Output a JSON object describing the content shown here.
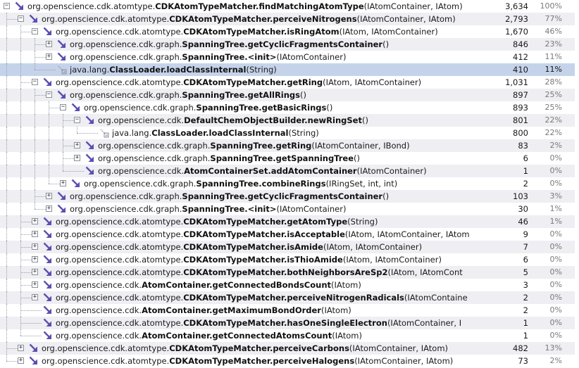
{
  "colors": {
    "selected_row": "#c5d3ea",
    "alt_row": "#eeeef3",
    "arrow_icon": "#5b4fb0"
  },
  "rows": [
    {
      "indent": 0,
      "toggle": "-",
      "icon": "arrow",
      "prefix": "org.opensciencecdk.atomtype.",
      "prefix_fix": "org.openscience.cdk.atomtype.",
      "bold": "CDKAtomTypeMatcher.findMatchingAtomType",
      "suffix": "(IAtomContainer, IAtom)",
      "count": "3,634",
      "pct": "100%"
    },
    {
      "indent": 1,
      "toggle": "-",
      "icon": "arrow",
      "prefix_fix": "org.openscience.cdk.atomtype.",
      "bold": "CDKAtomTypeMatcher.perceiveNitrogens",
      "suffix": "(IAtomContainer, IAtom)",
      "count": "2,793",
      "pct": "77%"
    },
    {
      "indent": 2,
      "toggle": "-",
      "icon": "arrow",
      "prefix_fix": "org.openscience.cdk.atomtype.",
      "bold": "CDKAtomTypeMatcher.isRingAtom",
      "suffix": "(IAtom, IAtomContainer)",
      "count": "1,670",
      "pct": "46%"
    },
    {
      "indent": 3,
      "toggle": "+",
      "icon": "arrow",
      "prefix_fix": "org.openscience.cdk.graph.",
      "bold": "SpanningTree.getCyclicFragmentsContainer",
      "suffix": "()",
      "count": "846",
      "pct": "23%"
    },
    {
      "indent": 3,
      "toggle": "+",
      "icon": "arrow",
      "prefix_fix": "org.openscience.cdk.graph.",
      "bold": "SpanningTree.<init>",
      "suffix": "(IAtomContainer)",
      "count": "412",
      "pct": "11%"
    },
    {
      "indent": 3,
      "toggle": "",
      "icon": "self",
      "prefix_fix": "java.lang.",
      "bold": "ClassLoader.loadClassInternal",
      "suffix": "(String)",
      "count": "410",
      "pct": "11%",
      "selected": true
    },
    {
      "indent": 2,
      "toggle": "-",
      "icon": "arrow",
      "prefix_fix": "org.openscience.cdk.atomtype.",
      "bold": "CDKAtomTypeMatcher.getRing",
      "suffix": "(IAtom, IAtomContainer)",
      "count": "1,031",
      "pct": "28%"
    },
    {
      "indent": 3,
      "toggle": "-",
      "icon": "arrow",
      "prefix_fix": "org.openscience.cdk.graph.",
      "bold": "SpanningTree.getAllRings",
      "suffix": "()",
      "count": "897",
      "pct": "25%"
    },
    {
      "indent": 4,
      "toggle": "-",
      "icon": "arrow",
      "prefix_fix": "org.openscience.cdk.graph.",
      "bold": "SpanningTree.getBasicRings",
      "suffix": "()",
      "count": "893",
      "pct": "25%"
    },
    {
      "indent": 5,
      "toggle": "-",
      "icon": "arrow",
      "prefix_fix": "org.openscience.cdk.",
      "bold": "DefaultChemObjectBuilder.newRingSet",
      "suffix": "()",
      "count": "801",
      "pct": "22%"
    },
    {
      "indent": 6,
      "toggle": "",
      "icon": "self",
      "prefix_fix": "java.lang.",
      "bold": "ClassLoader.loadClassInternal",
      "suffix": "(String)",
      "count": "800",
      "pct": "22%"
    },
    {
      "indent": 5,
      "toggle": "+",
      "icon": "arrow",
      "prefix_fix": "org.openscience.cdk.graph.",
      "bold": "SpanningTree.getRing",
      "suffix": "(IAtomContainer, IBond)",
      "count": "83",
      "pct": "2%"
    },
    {
      "indent": 5,
      "toggle": "+",
      "icon": "arrow",
      "prefix_fix": "org.openscience.cdk.graph.",
      "bold": "SpanningTree.getSpanningTree",
      "suffix": "()",
      "count": "6",
      "pct": "0%"
    },
    {
      "indent": 5,
      "toggle": "",
      "icon": "arrow",
      "prefix_fix": "org.openscience.cdk.",
      "bold": "AtomContainerSet.addAtomContainer",
      "suffix": "(IAtomContainer)",
      "count": "1",
      "pct": "0%"
    },
    {
      "indent": 4,
      "toggle": "+",
      "icon": "arrow",
      "prefix_fix": "org.openscience.cdk.graph.",
      "bold": "SpanningTree.combineRings",
      "suffix": "(IRingSet, int, int)",
      "count": "2",
      "pct": "0%"
    },
    {
      "indent": 3,
      "toggle": "+",
      "icon": "arrow",
      "prefix_fix": "org.openscience.cdk.graph.",
      "bold": "SpanningTree.getCyclicFragmentsContainer",
      "suffix": "()",
      "count": "103",
      "pct": "3%"
    },
    {
      "indent": 3,
      "toggle": "+",
      "icon": "arrow",
      "prefix_fix": "org.openscience.cdk.graph.",
      "bold": "SpanningTree.<init>",
      "suffix": "(IAtomContainer)",
      "count": "30",
      "pct": "1%"
    },
    {
      "indent": 2,
      "toggle": "+",
      "icon": "arrow",
      "prefix_fix": "org.openscience.cdk.atomtype.",
      "bold": "CDKAtomTypeMatcher.getAtomType",
      "suffix": "(String)",
      "count": "46",
      "pct": "1%"
    },
    {
      "indent": 2,
      "toggle": "+",
      "icon": "arrow",
      "prefix_fix": "org.openscience.cdk.atomtype.",
      "bold": "CDKAtomTypeMatcher.isAcceptable",
      "suffix": "(IAtom, IAtomContainer, IAtom",
      "count": "9",
      "pct": "0%"
    },
    {
      "indent": 2,
      "toggle": "+",
      "icon": "arrow",
      "prefix_fix": "org.openscience.cdk.atomtype.",
      "bold": "CDKAtomTypeMatcher.isAmide",
      "suffix": "(IAtom, IAtomContainer)",
      "count": "7",
      "pct": "0%"
    },
    {
      "indent": 2,
      "toggle": "+",
      "icon": "arrow",
      "prefix_fix": "org.openscience.cdk.atomtype.",
      "bold": "CDKAtomTypeMatcher.isThioAmide",
      "suffix": "(IAtom, IAtomContainer)",
      "count": "6",
      "pct": "0%"
    },
    {
      "indent": 2,
      "toggle": "+",
      "icon": "arrow",
      "prefix_fix": "org.openscience.cdk.atomtype.",
      "bold": "CDKAtomTypeMatcher.bothNeighborsAreSp2",
      "suffix": "(IAtom, IAtomCont",
      "count": "5",
      "pct": "0%"
    },
    {
      "indent": 2,
      "toggle": "+",
      "icon": "arrow",
      "prefix_fix": "org.openscience.cdk.",
      "bold": "AtomContainer.getConnectedBondsCount",
      "suffix": "(IAtom)",
      "count": "3",
      "pct": "0%"
    },
    {
      "indent": 2,
      "toggle": "+",
      "icon": "arrow",
      "prefix_fix": "org.openscience.cdk.atomtype.",
      "bold": "CDKAtomTypeMatcher.perceiveNitrogenRadicals",
      "suffix": "(IAtomContaine",
      "count": "2",
      "pct": "0%"
    },
    {
      "indent": 2,
      "toggle": "",
      "icon": "arrow",
      "prefix_fix": "org.openscience.cdk.",
      "bold": "AtomContainer.getMaximumBondOrder",
      "suffix": "(IAtom)",
      "count": "2",
      "pct": "0%"
    },
    {
      "indent": 2,
      "toggle": "",
      "icon": "arrow",
      "prefix_fix": "org.openscience.cdk.atomtype.",
      "bold": "CDKAtomTypeMatcher.hasOneSingleElectron",
      "suffix": "(IAtomContainer, I",
      "count": "1",
      "pct": "0%"
    },
    {
      "indent": 2,
      "toggle": "",
      "icon": "arrow",
      "prefix_fix": "org.openscience.cdk.",
      "bold": "AtomContainer.getConnectedAtomsCount",
      "suffix": "(IAtom)",
      "count": "1",
      "pct": "0%"
    },
    {
      "indent": 1,
      "toggle": "+",
      "icon": "arrow",
      "prefix_fix": "org.openscience.cdk.atomtype.",
      "bold": "CDKAtomTypeMatcher.perceiveCarbons",
      "suffix": "(IAtomContainer, IAtom)",
      "count": "482",
      "pct": "13%"
    },
    {
      "indent": 1,
      "toggle": "+",
      "icon": "arrow",
      "prefix_fix": "org.openscience.cdk.atomtype.",
      "bold": "CDKAtomTypeMatcher.perceiveHalogens",
      "suffix": "(IAtomContainer, IAtom)",
      "count": "73",
      "pct": "2%"
    }
  ]
}
